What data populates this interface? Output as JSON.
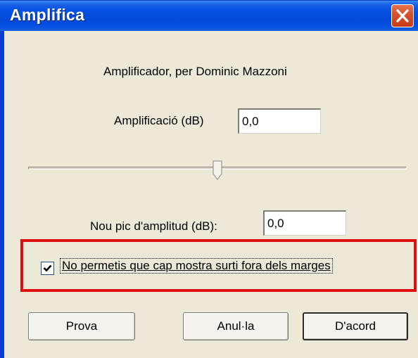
{
  "window": {
    "title": "Amplifica"
  },
  "icons": {
    "close": "close-icon",
    "check": "checkmark-icon"
  },
  "dialog": {
    "subtitle": "Amplificador, per Dominic Mazzoni",
    "amplification": {
      "label": "Amplificació (dB)",
      "value": "0,0"
    },
    "slider": {
      "position_fraction": 0.5
    },
    "new_peak": {
      "label": "Nou pic d'amplitud (dB):",
      "value": "0,0"
    },
    "clipping_checkbox": {
      "label": "No permetis que cap mostra surti fora dels marges",
      "checked": true
    }
  },
  "buttons": {
    "preview": "Prova",
    "cancel": "Anul·la",
    "ok": "D'acord"
  },
  "colors": {
    "titlebar": "#0553e3",
    "dialog_bg": "#ece9d8",
    "highlight": "#e00f0f",
    "close_button": "#d7522a"
  }
}
